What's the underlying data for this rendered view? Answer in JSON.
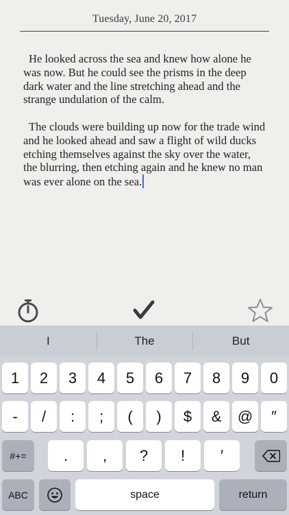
{
  "editor": {
    "date": "Tuesday, June 20, 2017",
    "paragraphs": [
      "He looked across the sea and knew how alone he was now. But he could see the prisms in the deep dark water and the line stretching ahead and the strange undulation of the calm.",
      "The clouds were building up now for the trade wind and he looked ahead and saw a flight of wild ducks etching themselves against the sky over the water, the blurring, then etching again and he knew no man was ever alone on the sea."
    ]
  },
  "toolbar": {
    "icons": [
      "stopwatch-icon",
      "checkmark-icon",
      "star-outline-icon"
    ]
  },
  "keyboard": {
    "suggestions": [
      "I",
      "The",
      "But"
    ],
    "row1": [
      "1",
      "2",
      "3",
      "4",
      "5",
      "6",
      "7",
      "8",
      "9",
      "0"
    ],
    "row2": [
      "-",
      "/",
      ":",
      ";",
      "(",
      ")",
      "$",
      "&",
      "@",
      "″"
    ],
    "row3": {
      "symbols_key": "#+=",
      "keys": [
        ".",
        ",",
        "?",
        "!",
        "′"
      ],
      "delete_icon": "delete-backspace-icon"
    },
    "row4": {
      "abc_key": "ABC",
      "emoji_icon": "emoji-icon",
      "space_key": "space",
      "return_key": "return"
    }
  },
  "colors": {
    "paper": "#f0efeb",
    "caret": "#3a6fe0",
    "keyboard_bg": "#d1d4db",
    "suggestion_bar": "#c9ced5",
    "key_light": "#ffffff",
    "key_dark": "#abb0ba"
  }
}
